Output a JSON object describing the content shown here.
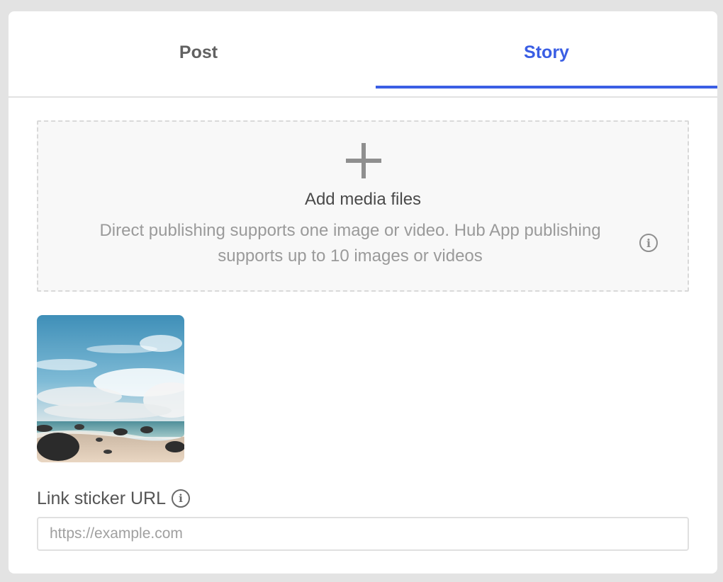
{
  "tabs": [
    {
      "label": "Post",
      "active": false
    },
    {
      "label": "Story",
      "active": true
    }
  ],
  "colors": {
    "accent": "#3a5ee4",
    "muted": "#9a9a9a",
    "background": "#e3e3e3"
  },
  "dropzone": {
    "icon": "plus-icon",
    "title": "Add media files",
    "description": "Direct publishing supports one image or video. Hub App publishing supports up to 10 images or videos",
    "info_icon": "info-icon"
  },
  "media": [
    {
      "type": "image",
      "icon": "beach-thumbnail"
    }
  ],
  "link_sticker": {
    "label": "Link sticker URL",
    "info_icon": "info-icon",
    "placeholder": "https://example.com",
    "value": ""
  }
}
